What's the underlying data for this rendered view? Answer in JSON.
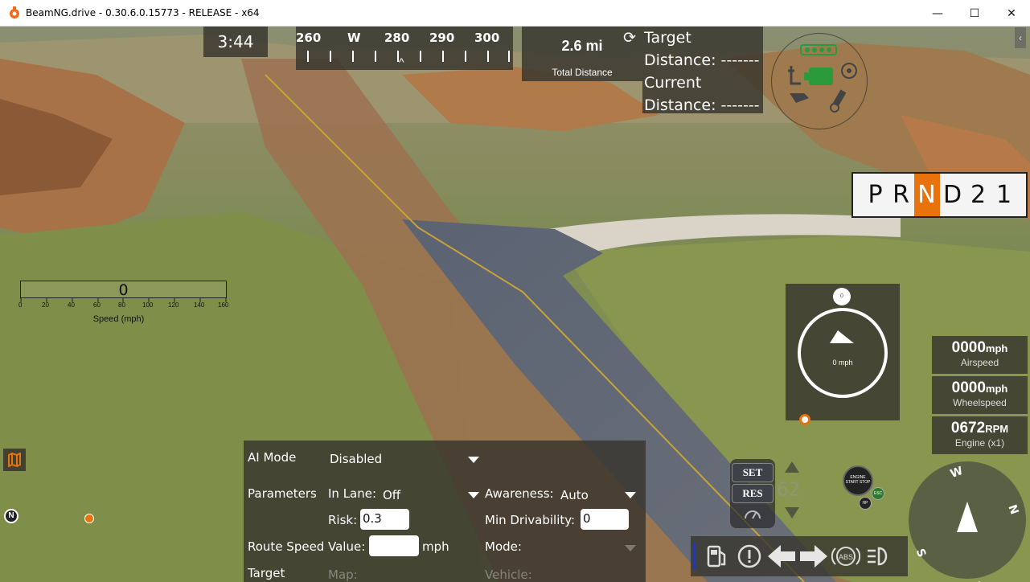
{
  "window": {
    "title": "BeamNG.drive - 0.30.6.0.15773 - RELEASE - x64",
    "minimize": "—",
    "maximize": "☐",
    "close": "✕"
  },
  "hud": {
    "clock": "3:44",
    "compass_strip": {
      "labels": [
        "260",
        "W",
        "280",
        "290",
        "300"
      ],
      "caret": "^"
    },
    "distance": {
      "value": "2.6 mi",
      "label": "Total Distance"
    },
    "target": {
      "line1": "Target",
      "line2": "Distance: -------",
      "line3": "Current",
      "line4": "Distance: -------"
    },
    "side_tab": "‹",
    "gears": [
      "P",
      "R",
      "N",
      "D",
      "2",
      "1"
    ],
    "active_gear": "N",
    "speedometer_bar": {
      "value": "0",
      "ticks": [
        "0",
        "20",
        "40",
        "60",
        "80",
        "100",
        "120",
        "140",
        "160"
      ],
      "label": "Speed (mph)"
    },
    "nav_gauge": {
      "knob": "0",
      "speed": "0 mph"
    },
    "stats": [
      {
        "value": "0000",
        "unit": "mph",
        "label": "Airspeed"
      },
      {
        "value": "0000",
        "unit": "mph",
        "label": "Wheelspeed"
      },
      {
        "value": "0672",
        "unit": "RPM",
        "label": "Engine (x1)"
      }
    ],
    "minimap_north": "N",
    "round_compass": {
      "w": "W",
      "n": "N",
      "s": "S",
      "e": "E"
    },
    "cruise": {
      "set": "SET",
      "res": "RES",
      "speed": "62"
    },
    "start_stop": "ENGINE START STOP",
    "esc": "ESC",
    "hp": "HP"
  },
  "ai_panel": {
    "ai_mode_label": "AI Mode",
    "ai_mode_value": "Disabled",
    "parameters_label": "Parameters",
    "in_lane_label": "In Lane:",
    "in_lane_value": "Off",
    "awareness_label": "Awareness:",
    "awareness_value": "Auto",
    "risk_label": "Risk:",
    "risk_value": "0.3",
    "min_drivability_label": "Min Drivability:",
    "min_drivability_value": "0",
    "route_speed_label": "Route Speed",
    "value_label": "Value:",
    "value_input": "",
    "mph_label": "mph",
    "mode_label": "Mode:",
    "target_label": "Target",
    "map_label": "Map:",
    "vehicle_label": "Vehicle:"
  },
  "colors": {
    "accent": "#e8720c",
    "panel": "#37342d"
  }
}
